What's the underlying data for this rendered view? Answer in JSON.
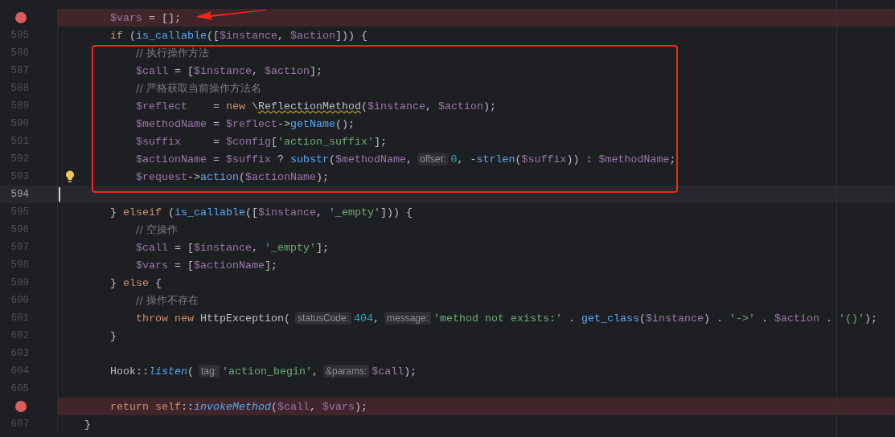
{
  "editor": {
    "lines": [
      {
        "kind": "body",
        "breakpoint": true,
        "current": false,
        "bulb": false,
        "tokens": [
          {
            "kind": "var",
            "text": "$vars"
          },
          {
            "kind": "plain",
            "text": " = [];"
          }
        ]
      },
      {
        "number": "585",
        "kind": "body",
        "breakpoint": false,
        "current": false,
        "bulb": false,
        "tokens": [
          {
            "kind": "kw",
            "text": "if"
          },
          {
            "kind": "plain",
            "text": " ("
          },
          {
            "kind": "fn",
            "text": "is_callable"
          },
          {
            "kind": "plain",
            "text": "(["
          },
          {
            "kind": "var",
            "text": "$instance"
          },
          {
            "kind": "plain",
            "text": ", "
          },
          {
            "kind": "var",
            "text": "$action"
          },
          {
            "kind": "plain",
            "text": "])) {"
          }
        ]
      },
      {
        "number": "586",
        "kind": "nested",
        "breakpoint": false,
        "current": false,
        "bulb": false,
        "tokens": [
          {
            "kind": "comment",
            "text": "// 执行操作方法"
          }
        ]
      },
      {
        "number": "587",
        "kind": "nested",
        "breakpoint": false,
        "current": false,
        "bulb": false,
        "tokens": [
          {
            "kind": "var",
            "text": "$call"
          },
          {
            "kind": "plain",
            "text": " = ["
          },
          {
            "kind": "var",
            "text": "$instance"
          },
          {
            "kind": "plain",
            "text": ", "
          },
          {
            "kind": "var",
            "text": "$action"
          },
          {
            "kind": "plain",
            "text": "];"
          }
        ]
      },
      {
        "number": "588",
        "kind": "nested",
        "breakpoint": false,
        "current": false,
        "bulb": false,
        "tokens": [
          {
            "kind": "comment",
            "text": "// 严格获取当前操作方法名"
          }
        ]
      },
      {
        "number": "589",
        "kind": "nested",
        "breakpoint": false,
        "current": false,
        "bulb": false,
        "tokens": [
          {
            "kind": "var",
            "text": "$reflect"
          },
          {
            "kind": "plain",
            "text": "    = "
          },
          {
            "kind": "kw",
            "text": "new"
          },
          {
            "kind": "plain",
            "text": " \\"
          },
          {
            "kind": "warn",
            "text": "ReflectionMethod"
          },
          {
            "kind": "plain",
            "text": "("
          },
          {
            "kind": "var",
            "text": "$instance"
          },
          {
            "kind": "plain",
            "text": ", "
          },
          {
            "kind": "var",
            "text": "$action"
          },
          {
            "kind": "plain",
            "text": ");"
          }
        ]
      },
      {
        "number": "590",
        "kind": "nested",
        "breakpoint": false,
        "current": false,
        "bulb": false,
        "tokens": [
          {
            "kind": "var",
            "text": "$methodName"
          },
          {
            "kind": "plain",
            "text": " = "
          },
          {
            "kind": "var",
            "text": "$reflect"
          },
          {
            "kind": "plain",
            "text": "->"
          },
          {
            "kind": "fn",
            "text": "getName"
          },
          {
            "kind": "plain",
            "text": "();"
          }
        ]
      },
      {
        "number": "591",
        "kind": "nested",
        "breakpoint": false,
        "current": false,
        "bulb": false,
        "tokens": [
          {
            "kind": "var",
            "text": "$suffix"
          },
          {
            "kind": "plain",
            "text": "     = "
          },
          {
            "kind": "var",
            "text": "$config"
          },
          {
            "kind": "plain",
            "text": "["
          },
          {
            "kind": "str",
            "text": "'action_suffix'"
          },
          {
            "kind": "plain",
            "text": "];"
          }
        ]
      },
      {
        "number": "592",
        "kind": "nested",
        "breakpoint": false,
        "current": false,
        "bulb": false,
        "tokens": [
          {
            "kind": "var",
            "text": "$actionName"
          },
          {
            "kind": "plain",
            "text": " = "
          },
          {
            "kind": "var",
            "text": "$suffix"
          },
          {
            "kind": "plain",
            "text": " ? "
          },
          {
            "kind": "fn",
            "text": "substr"
          },
          {
            "kind": "plain",
            "text": "("
          },
          {
            "kind": "var",
            "text": "$methodName"
          },
          {
            "kind": "plain",
            "text": ","
          },
          {
            "kind": "hint",
            "text": "offset:"
          },
          {
            "kind": "num",
            "text": "0"
          },
          {
            "kind": "plain",
            "text": ", -"
          },
          {
            "kind": "fn",
            "text": "strlen"
          },
          {
            "kind": "plain",
            "text": "("
          },
          {
            "kind": "var",
            "text": "$suffix"
          },
          {
            "kind": "plain",
            "text": ")) : "
          },
          {
            "kind": "var",
            "text": "$methodName"
          },
          {
            "kind": "plain",
            "text": ";"
          }
        ]
      },
      {
        "number": "593",
        "kind": "nested",
        "breakpoint": false,
        "current": false,
        "bulb": true,
        "tokens": [
          {
            "kind": "var",
            "text": "$request"
          },
          {
            "kind": "plain",
            "text": "->"
          },
          {
            "kind": "fn",
            "text": "action"
          },
          {
            "kind": "plain",
            "text": "("
          },
          {
            "kind": "var",
            "text": "$actionName"
          },
          {
            "kind": "plain",
            "text": ");"
          }
        ]
      },
      {
        "number": "594",
        "breakpoint": false,
        "current": true,
        "bulb": false
      },
      {
        "number": "595",
        "kind": "body",
        "breakpoint": false,
        "current": false,
        "bulb": false,
        "tokens": [
          {
            "kind": "plain",
            "text": "} "
          },
          {
            "kind": "kw",
            "text": "elseif"
          },
          {
            "kind": "plain",
            "text": " ("
          },
          {
            "kind": "fn",
            "text": "is_callable"
          },
          {
            "kind": "plain",
            "text": "(["
          },
          {
            "kind": "var",
            "text": "$instance"
          },
          {
            "kind": "plain",
            "text": ", "
          },
          {
            "kind": "str",
            "text": "'_empty'"
          },
          {
            "kind": "plain",
            "text": "])) {"
          }
        ]
      },
      {
        "number": "596",
        "kind": "nested",
        "breakpoint": false,
        "current": false,
        "bulb": false,
        "tokens": [
          {
            "kind": "comment",
            "text": "// 空操作"
          }
        ]
      },
      {
        "number": "597",
        "kind": "nested",
        "breakpoint": false,
        "current": false,
        "bulb": false,
        "tokens": [
          {
            "kind": "var",
            "text": "$call"
          },
          {
            "kind": "plain",
            "text": " = ["
          },
          {
            "kind": "var",
            "text": "$instance"
          },
          {
            "kind": "plain",
            "text": ", "
          },
          {
            "kind": "str",
            "text": "'_empty'"
          },
          {
            "kind": "plain",
            "text": "];"
          }
        ]
      },
      {
        "number": "598",
        "kind": "nested",
        "breakpoint": false,
        "current": false,
        "bulb": false,
        "tokens": [
          {
            "kind": "var",
            "text": "$vars"
          },
          {
            "kind": "plain",
            "text": " = ["
          },
          {
            "kind": "var",
            "text": "$actionName"
          },
          {
            "kind": "plain",
            "text": "];"
          }
        ]
      },
      {
        "number": "599",
        "kind": "body",
        "breakpoint": false,
        "current": false,
        "bulb": false,
        "tokens": [
          {
            "kind": "plain",
            "text": "} "
          },
          {
            "kind": "kw",
            "text": "else"
          },
          {
            "kind": "plain",
            "text": " {"
          }
        ]
      },
      {
        "number": "600",
        "kind": "nested",
        "breakpoint": false,
        "current": false,
        "bulb": false,
        "tokens": [
          {
            "kind": "comment",
            "text": "// 操作不存在"
          }
        ]
      },
      {
        "number": "601",
        "kind": "nested",
        "breakpoint": false,
        "current": false,
        "bulb": false,
        "tokens": [
          {
            "kind": "kw",
            "text": "throw new"
          },
          {
            "kind": "plain",
            "text": " HttpException("
          },
          {
            "kind": "hint",
            "text": "statusCode:"
          },
          {
            "kind": "num",
            "text": "404"
          },
          {
            "kind": "plain",
            "text": ","
          },
          {
            "kind": "hint",
            "text": "message:"
          },
          {
            "kind": "str",
            "text": "'method not exists:'"
          },
          {
            "kind": "plain",
            "text": " . "
          },
          {
            "kind": "fn",
            "text": "get_class"
          },
          {
            "kind": "plain",
            "text": "("
          },
          {
            "kind": "var",
            "text": "$instance"
          },
          {
            "kind": "plain",
            "text": ") . "
          },
          {
            "kind": "str",
            "text": "'->'"
          },
          {
            "kind": "plain",
            "text": " . "
          },
          {
            "kind": "var",
            "text": "$action"
          },
          {
            "kind": "plain",
            "text": " . "
          },
          {
            "kind": "str",
            "text": "'()'"
          },
          {
            "kind": "plain",
            "text": ");"
          }
        ]
      },
      {
        "number": "602",
        "kind": "body",
        "breakpoint": false,
        "current": false,
        "bulb": false,
        "tokens": [
          {
            "kind": "plain",
            "text": "}"
          }
        ]
      },
      {
        "number": "603",
        "breakpoint": false,
        "current": false,
        "bulb": false
      },
      {
        "number": "604",
        "kind": "body",
        "breakpoint": false,
        "current": false,
        "bulb": false,
        "tokens": [
          {
            "kind": "plain",
            "text": "Hook::"
          },
          {
            "kind": "static",
            "text": "listen"
          },
          {
            "kind": "plain",
            "text": "("
          },
          {
            "kind": "hint",
            "text": "tag:"
          },
          {
            "kind": "str",
            "text": "'action_begin'"
          },
          {
            "kind": "plain",
            "text": ","
          },
          {
            "kind": "hint",
            "text": "&params:"
          },
          {
            "kind": "var",
            "text": "$call"
          },
          {
            "kind": "plain",
            "text": ");"
          }
        ]
      },
      {
        "number": "605",
        "breakpoint": false,
        "current": false,
        "bulb": false
      },
      {
        "kind": "body",
        "breakpoint": true,
        "current": false,
        "bulb": false,
        "tokens": [
          {
            "kind": "kw",
            "text": "return self"
          },
          {
            "kind": "plain",
            "text": "::"
          },
          {
            "kind": "static",
            "text": "invokeMethod"
          },
          {
            "kind": "plain",
            "text": "("
          },
          {
            "kind": "var",
            "text": "$call"
          },
          {
            "kind": "plain",
            "text": ", "
          },
          {
            "kind": "var",
            "text": "$vars"
          },
          {
            "kind": "plain",
            "text": ");"
          }
        ]
      },
      {
        "number": "607",
        "kind": "top",
        "breakpoint": false,
        "current": false,
        "bulb": false,
        "tokens": [
          {
            "kind": "plain",
            "text": "}"
          }
        ]
      }
    ]
  }
}
